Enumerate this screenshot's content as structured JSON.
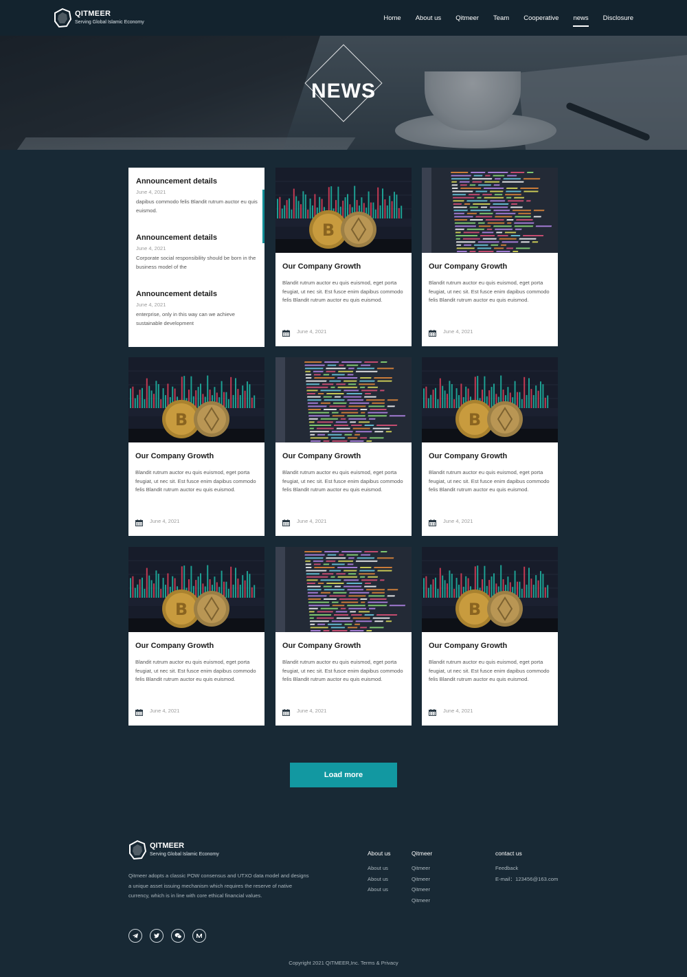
{
  "brand": {
    "name": "QITMEER",
    "tagline": "Serving Global Islamic Economy"
  },
  "nav": [
    "Home",
    "About us",
    "Qitmeer",
    "Team",
    "Cooperative",
    "news",
    "Disclosure"
  ],
  "active_nav": "news",
  "hero": {
    "title": "NEWS"
  },
  "announcements": [
    {
      "title": "Announcement details",
      "date": "June 4, 2021",
      "text": "dapibus commodo felis Blandit rutrum auctor eu quis euismod."
    },
    {
      "title": "Announcement details",
      "date": "June 4, 2021",
      "text": "Corporate social responsibility should be born in the business model of the"
    },
    {
      "title": "Announcement details",
      "date": "June 4, 2021",
      "text": "enterprise, only in this way can we achieve sustainable development"
    }
  ],
  "cards": [
    {
      "image": "bitcoin",
      "title": "Our Company Growth",
      "text": "Blandit rutrum auctor eu quis euismod, eget porta feugiat, ut nec sit. Est fusce enim dapibus commodo felis Blandit rutrum auctor eu quis euismod.",
      "date": "June 4, 2021"
    },
    {
      "image": "code",
      "title": "Our Company Growth",
      "text": "Blandit rutrum auctor eu quis euismod, eget porta feugiat, ut nec sit. Est fusce enim dapibus commodo felis Blandit rutrum auctor eu quis euismod.",
      "date": "June 4, 2021"
    },
    {
      "image": "bitcoin",
      "title": "Our Company Growth",
      "text": "Blandit rutrum auctor eu quis euismod, eget porta feugiat, ut nec sit. Est fusce enim dapibus commodo felis Blandit rutrum auctor eu quis euismod.",
      "date": "June 4, 2021"
    },
    {
      "image": "code",
      "title": "Our Company Growth",
      "text": "Blandit rutrum auctor eu quis euismod, eget porta feugiat, ut nec sit. Est fusce enim dapibus commodo felis Blandit rutrum auctor eu quis euismod.",
      "date": "June 4, 2021"
    },
    {
      "image": "bitcoin",
      "title": "Our Company Growth",
      "text": "Blandit rutrum auctor eu quis euismod, eget porta feugiat, ut nec sit. Est fusce enim dapibus commodo felis Blandit rutrum auctor eu quis euismod.",
      "date": "June 4, 2021"
    },
    {
      "image": "bitcoin",
      "title": "Our Company Growth",
      "text": "Blandit rutrum auctor eu quis euismod, eget porta feugiat, ut nec sit. Est fusce enim dapibus commodo felis Blandit rutrum auctor eu quis euismod.",
      "date": "June 4, 2021"
    },
    {
      "image": "code",
      "title": "Our Company Growth",
      "text": "Blandit rutrum auctor eu quis euismod, eget porta feugiat, ut nec sit. Est fusce enim dapibus commodo felis Blandit rutrum auctor eu quis euismod.",
      "date": "June 4, 2021"
    },
    {
      "image": "bitcoin",
      "title": "Our Company Growth",
      "text": "Blandit rutrum auctor eu quis euismod, eget porta feugiat, ut nec sit. Est fusce enim dapibus commodo felis Blandit rutrum auctor eu quis euismod.",
      "date": "June 4, 2021"
    }
  ],
  "load_more": "Load more",
  "footer": {
    "description": "Qitmeer adopts a classic POW consensus and UTXO data model and designs a unique asset issuing mechanism which requires the reserve of native currency, which is in line with core ethical financial values.",
    "columns": [
      {
        "heading": "About us",
        "links": [
          "About us",
          "About us",
          "About us"
        ]
      },
      {
        "heading": "Qitmeer",
        "links": [
          "Qitmeer",
          "Qitmeer",
          "Qitmeer",
          "Qitmeer"
        ]
      },
      {
        "heading": "contact us",
        "links": [
          "Feedback",
          "E-mail：123456@163.com"
        ]
      }
    ],
    "socials": [
      "telegram-icon",
      "twitter-icon",
      "wechat-icon",
      "medium-icon"
    ],
    "copyright": "Copyright 2021 QITMEER,Inc. Terms & Privacy"
  },
  "colors": {
    "page_bg": "#182935",
    "header_bg": "#13232e",
    "accent": "#1298a1"
  }
}
